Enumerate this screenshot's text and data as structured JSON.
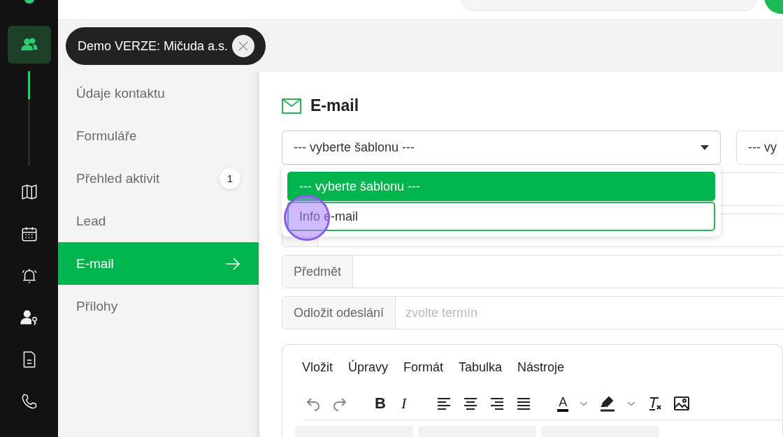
{
  "rail": {
    "items": [
      {
        "kind": "people",
        "selected": true
      },
      {
        "kind": "map",
        "selected": false
      },
      {
        "kind": "calendar",
        "selected": false
      },
      {
        "kind": "bell",
        "selected": false
      },
      {
        "kind": "user-key",
        "selected": false
      },
      {
        "kind": "document",
        "selected": false
      },
      {
        "kind": "phone",
        "selected": false
      }
    ]
  },
  "tag": {
    "label": "Demo VERZE: Mičuda a.s."
  },
  "sidebar": {
    "items": [
      {
        "label": "Údaje kontaktu",
        "selected": false
      },
      {
        "label": "Formuláře",
        "selected": false
      },
      {
        "label": "Přehled aktivit",
        "selected": false,
        "badge": "1"
      },
      {
        "label": "Lead",
        "selected": false
      },
      {
        "label": "E-mail",
        "selected": true
      },
      {
        "label": "Přílohy",
        "selected": false
      }
    ]
  },
  "email": {
    "title": "E-mail",
    "template_select": {
      "value": "--- vyberte šablonu ---",
      "expanded": true
    },
    "second_select": {
      "value": "--- vy"
    },
    "dropdown": {
      "options": [
        {
          "label": "--- vyberte šablonu ---",
          "selected": true,
          "hovered": false
        },
        {
          "label": "Info e-mail",
          "selected": false,
          "hovered": true
        }
      ]
    },
    "fields": [
      {
        "label": "Předmět"
      },
      {
        "label": "Odložit odeslání",
        "placeholder": "zvolte termín"
      }
    ],
    "editor": {
      "menu": [
        "Vložit",
        "Úpravy",
        "Formát",
        "Tabulka",
        "Nástroje"
      ],
      "toolbar": [
        {
          "kind": "undo"
        },
        {
          "kind": "redo"
        },
        {
          "kind": "bold",
          "label": "B"
        },
        {
          "kind": "italic",
          "label": "I"
        },
        {
          "kind": "align-left"
        },
        {
          "kind": "align-center"
        },
        {
          "kind": "align-right"
        },
        {
          "kind": "justify"
        },
        {
          "kind": "text-color",
          "label": "A"
        },
        {
          "kind": "caret"
        },
        {
          "kind": "highlight"
        },
        {
          "kind": "caret"
        },
        {
          "kind": "clear-format"
        },
        {
          "kind": "image"
        }
      ]
    }
  }
}
